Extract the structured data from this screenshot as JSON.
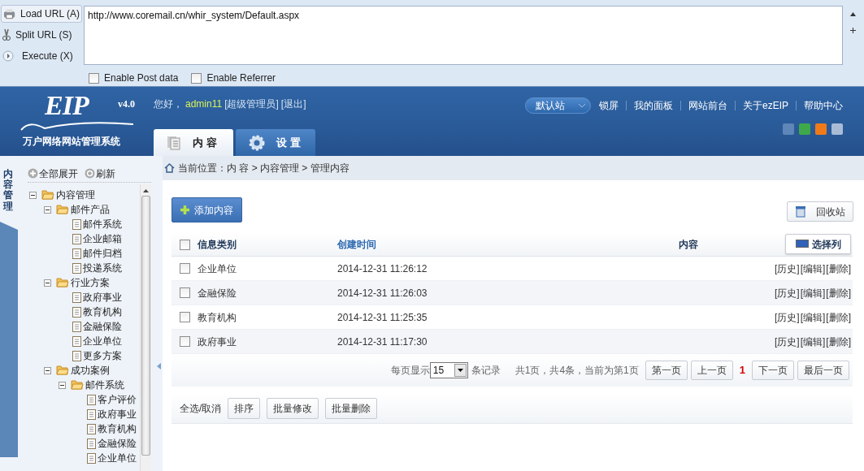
{
  "toolbar": {
    "buttons": [
      {
        "label": "Load URL (A)",
        "kind": "load"
      },
      {
        "label": "Split URL (S)",
        "kind": "split"
      },
      {
        "label": "Execute (X)",
        "kind": "execute"
      }
    ],
    "url": "http://www.coremail.cn/whir_system/Default.aspx",
    "options": [
      {
        "label": "Enable Post data",
        "checked": false
      },
      {
        "label": "Enable Referrer",
        "checked": false
      }
    ]
  },
  "header": {
    "logo": {
      "mark": "EIP",
      "version": "v4.0",
      "subtitle": "万户网络网站管理系统"
    },
    "greeting": "您好，",
    "user": "admin11",
    "role": "[超级管理员]",
    "logout": "[退出]",
    "tabs": [
      {
        "label": "内 容",
        "kind": "content",
        "selected": true
      },
      {
        "label": "设 置",
        "kind": "settings",
        "selected": false
      }
    ],
    "site": "默认站",
    "links": [
      "锁屏",
      "我的面板",
      "网站前台",
      "关于ezEIP",
      "帮助中心"
    ],
    "themes": [
      {
        "color": "#5f86b8"
      },
      {
        "color": "#3fa84a"
      },
      {
        "color": "#f07a1a"
      },
      {
        "color": "#a9bcd6"
      }
    ]
  },
  "sidebar": {
    "title": "内容管理",
    "expand_all": "全部展开",
    "refresh": "刷新",
    "tree": [
      {
        "label": "内容管理",
        "expanded": true,
        "children": [
          {
            "label": "邮件产品",
            "expanded": true,
            "children": [
              {
                "label": "邮件系统"
              },
              {
                "label": "企业邮箱"
              },
              {
                "label": "邮件归档"
              },
              {
                "label": "投递系统"
              }
            ]
          },
          {
            "label": "行业方案",
            "expanded": true,
            "children": [
              {
                "label": "政府事业"
              },
              {
                "label": "教育机构"
              },
              {
                "label": "金融保险"
              },
              {
                "label": "企业单位"
              },
              {
                "label": "更多方案"
              }
            ]
          },
          {
            "label": "成功案例",
            "expanded": true,
            "children": [
              {
                "label": "邮件系统",
                "expanded": true,
                "children": [
                  {
                    "label": "客户评价"
                  },
                  {
                    "label": "政府事业"
                  },
                  {
                    "label": "教育机构"
                  },
                  {
                    "label": "金融保险"
                  },
                  {
                    "label": "企业单位"
                  }
                ]
              }
            ]
          }
        ]
      }
    ]
  },
  "breadcrumb": {
    "label": "当前位置：",
    "path": "内 容 > 内容管理 > 管理内容"
  },
  "add_button": "添加内容",
  "recycle_button": "回收站",
  "choose_columns": "选择列",
  "table": {
    "select_all": false,
    "columns": [
      {
        "label": "信息类别",
        "link": false
      },
      {
        "label": "创建时间",
        "link": true
      },
      {
        "label": "内容",
        "link": false
      }
    ],
    "rows": [
      {
        "category": "企业单位",
        "time": "2014-12-31 11:26:12",
        "actions": [
          "[历史]",
          "[编辑]",
          "[删除]"
        ],
        "checked": false
      },
      {
        "category": "金融保险",
        "time": "2014-12-31 11:26:03",
        "actions": [
          "[历史]",
          "[编辑]",
          "[删除]"
        ],
        "checked": false
      },
      {
        "category": "教育机构",
        "time": "2014-12-31 11:25:35",
        "actions": [
          "[历史]",
          "[编辑]",
          "[删除]"
        ],
        "checked": false
      },
      {
        "category": "政府事业",
        "time": "2014-12-31 11:17:30",
        "actions": [
          "[历史]",
          "[编辑]",
          "[删除]"
        ],
        "checked": false
      }
    ]
  },
  "pagination": {
    "per_page_label": "每页显示",
    "per_page": "15",
    "records_label": "条记录",
    "summary": "共1页，共4条，当前为第1页",
    "buttons": [
      "第一页",
      "上一页"
    ],
    "current": "1",
    "buttons_after": [
      "下一页",
      "最后一页"
    ]
  },
  "bulk": {
    "label": "全选/取消",
    "buttons": [
      "排序",
      "批量修改",
      "批量删除"
    ]
  }
}
